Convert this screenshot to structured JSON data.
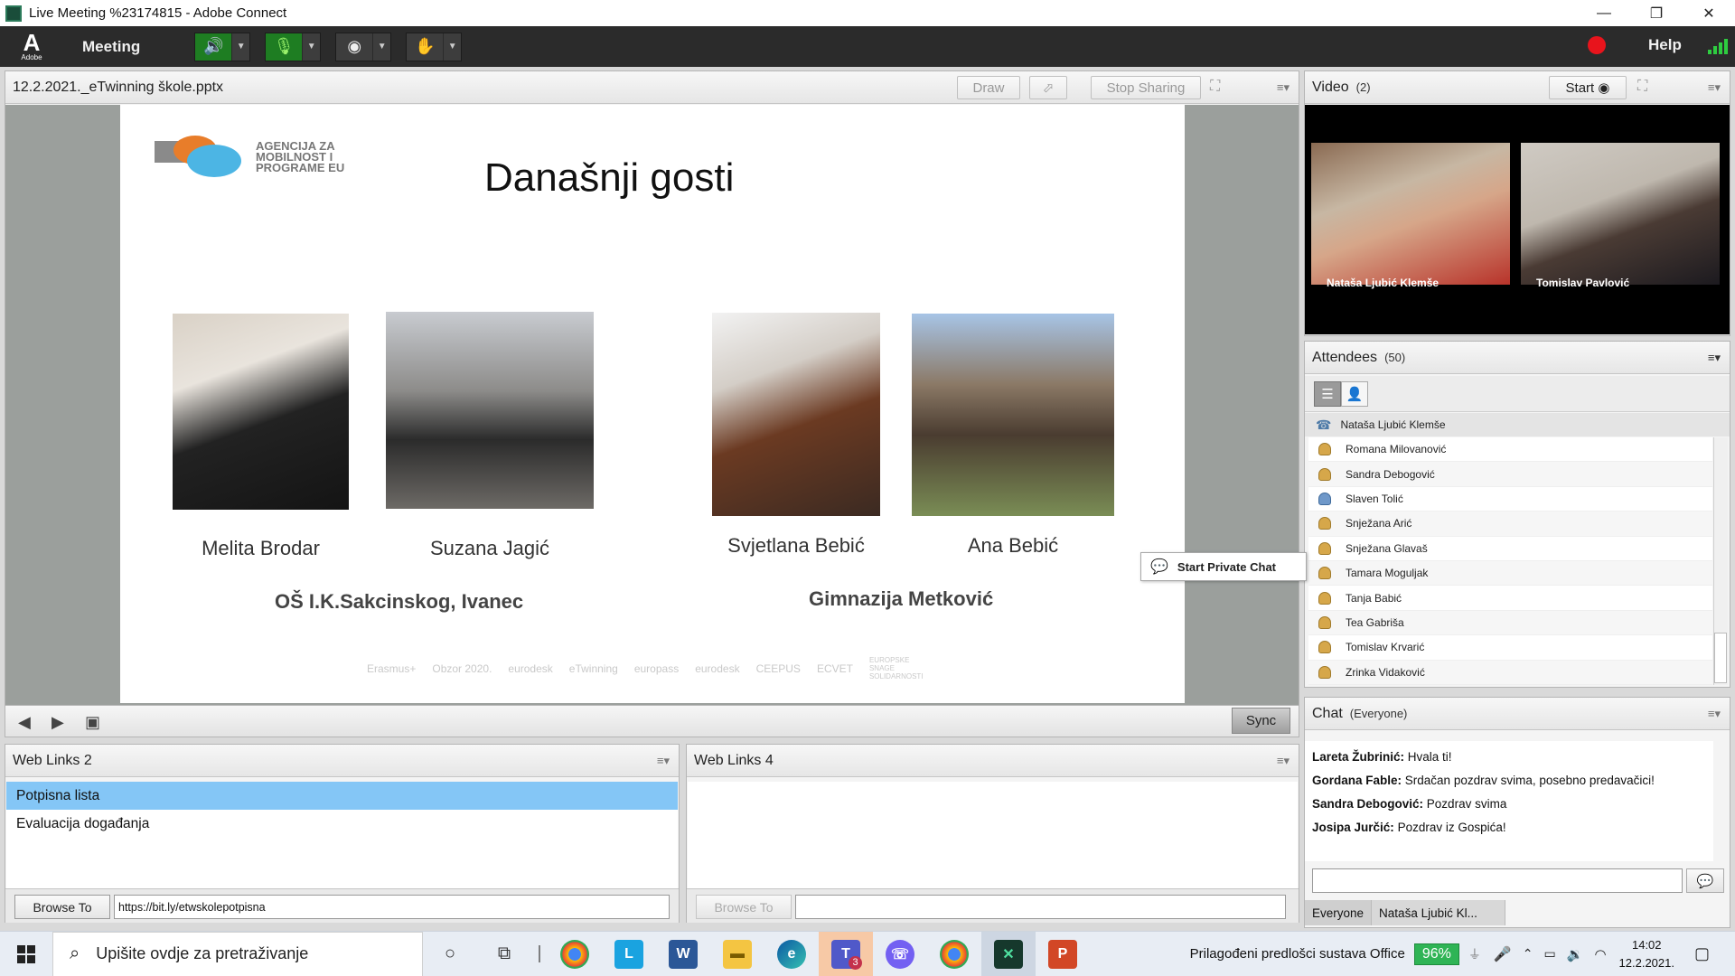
{
  "window": {
    "title": "Live Meeting %23174815 - Adobe Connect",
    "minimize": "—",
    "maximize": "❐",
    "close": "✕"
  },
  "menubar": {
    "logo_text": "Adobe",
    "meeting": "Meeting",
    "help": "Help"
  },
  "share_pod": {
    "title": "12.2.2021._eTwinning škole.pptx",
    "draw": "Draw",
    "stop_sharing": "Stop Sharing",
    "sync": "Sync"
  },
  "slide": {
    "agency": "AGENCIJA ZA MOBILNOST I PROGRAME EU",
    "title": "Današnji gosti",
    "people": [
      "Melita Brodar",
      "Suzana Jagić",
      "Svjetlana Bebić",
      "Ana Bebić"
    ],
    "schools": [
      "OŠ I.K.Sakcinskog, Ivanec",
      "Gimnazija Metković"
    ],
    "footer_logos": [
      "Erasmus+",
      "Obzor 2020.",
      "eurodesk",
      "eTwinning",
      "europass",
      "eurodesk",
      "CEEPUS",
      "ECVET",
      "EUROPSKE SNAGE SOLIDARNOSTI"
    ]
  },
  "video_pod": {
    "title": "Video",
    "count": "(2)",
    "start": "Start",
    "participants": [
      "Nataša Ljubić Klemše",
      "Tomislav Pavlović"
    ]
  },
  "attendees_pod": {
    "title": "Attendees",
    "count": "(50)",
    "host": "Nataša Ljubić Klemše",
    "list": [
      "Romana Milovanović",
      "Sandra Debogović",
      "Slaven Tolić",
      "Snježana Arić",
      "Snježana Glavaš",
      "Tamara Moguljak",
      "Tanja Babić",
      "Tea Gabriša",
      "Tomislav Krvarić",
      "Zrinka Vidaković"
    ],
    "context_menu": "Start Private Chat"
  },
  "chat_pod": {
    "title": "Chat",
    "scope": "(Everyone)",
    "messages": [
      {
        "author": "Lareta Žubrinić:",
        "text": "Hvala ti!"
      },
      {
        "author": "Gordana Fable:",
        "text": "Srdačan pozdrav svima, posebno predavačici!"
      },
      {
        "author": "Sandra Debogović:",
        "text": "Pozdrav svima"
      },
      {
        "author": "Josipa Jurčić:",
        "text": "Pozdrav iz Gospića!"
      }
    ],
    "tabs": [
      "Everyone",
      "Nataša Ljubić Kl..."
    ]
  },
  "weblinks2": {
    "title": "Web Links 2",
    "items": [
      "Potpisna lista",
      "Evaluacija događanja"
    ],
    "browse": "Browse To",
    "url": "https://bit.ly/etwskolepotpisna"
  },
  "weblinks4": {
    "title": "Web Links 4",
    "browse": "Browse To",
    "url": ""
  },
  "taskbar": {
    "search_placeholder": "Upišite ovdje za pretraživanje",
    "tray_label": "Prilagođeni predlošci sustava Office",
    "battery": "96%",
    "time": "14:02",
    "date": "12.2.2021.",
    "teams_badge": "3"
  },
  "colors": {
    "accent_blue": "#84c6f6",
    "record_red": "#e8141c",
    "signal_green": "#2ecc40"
  }
}
